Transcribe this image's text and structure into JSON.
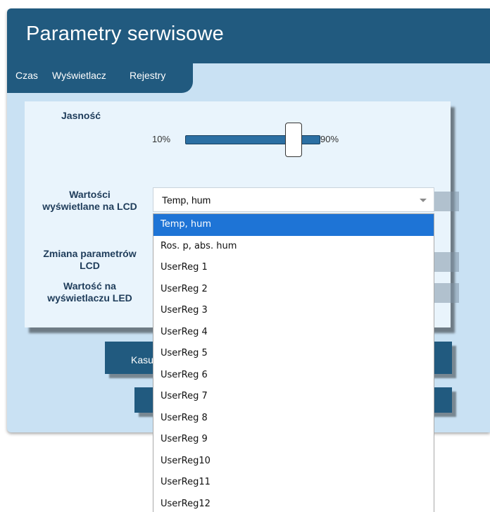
{
  "title": "Parametry serwisowe",
  "tabs": [
    {
      "label": "Czas"
    },
    {
      "label": "Wyświetlacz"
    },
    {
      "label": "Rejestry"
    }
  ],
  "brightness": {
    "label": "Jasność",
    "min_label": "10%",
    "max_label": "90%",
    "value_fraction": 0.8
  },
  "lcd_values": {
    "label_line1": "Wartości",
    "label_line2": "wyświetlane na LCD",
    "selected": "Temp, hum",
    "options": [
      "Temp, hum",
      "Ros. p, abs. hum",
      "UserReg 1",
      "UserReg 2",
      "UserReg 3",
      "UserReg 4",
      "UserReg 5",
      "UserReg 6",
      "UserReg 7",
      "UserReg 8",
      "UserReg 9",
      "UserReg10",
      "UserReg11",
      "UserReg12"
    ]
  },
  "lcd_params": {
    "label_line1": "Zmiana parametrów",
    "label_line2": "LCD"
  },
  "led_value": {
    "label_line1": "Wartość na",
    "label_line2": "wyświetlaczu LED"
  },
  "buttons": {
    "reset_label_partial": "Kasu"
  },
  "colors": {
    "header": "#215a7f",
    "background": "#c9e1f3",
    "panel": "#e9f4fc",
    "selected_option": "#1e74d6"
  }
}
